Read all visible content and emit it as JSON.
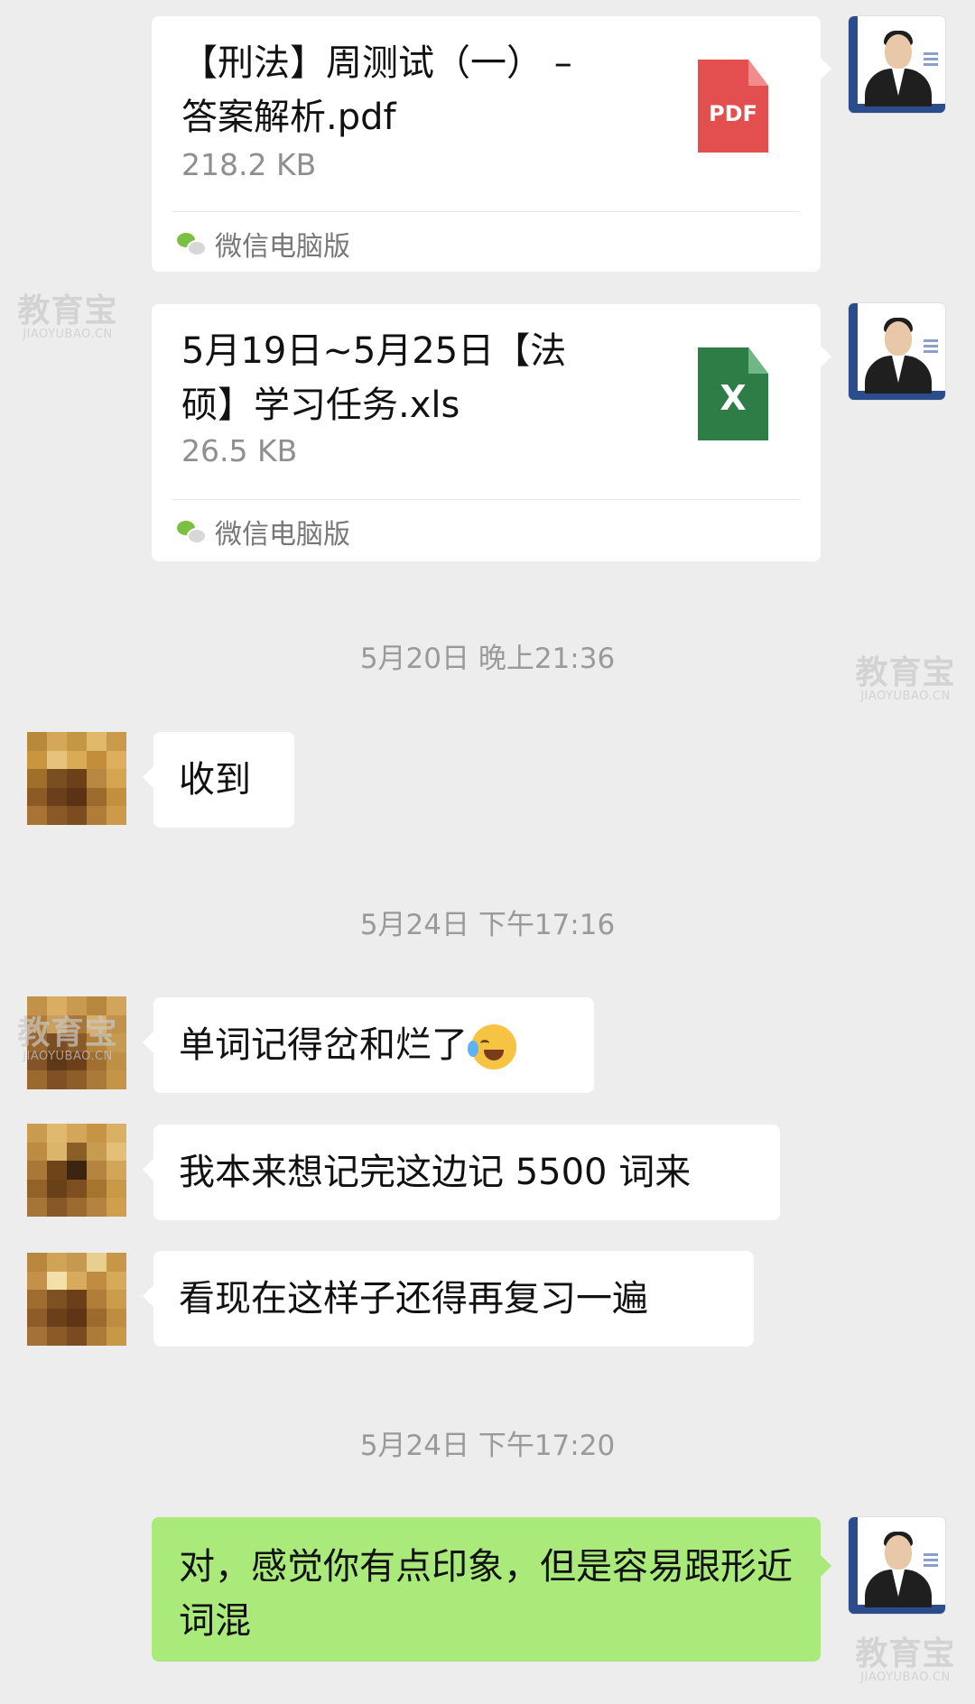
{
  "messages": {
    "file1": {
      "title": "【刑法】周测试（一） – 答案解析.pdf",
      "size": "218.2 KB",
      "source": "微信电脑版",
      "icon": "pdf-file-icon",
      "icon_label": "PDF",
      "icon_color": "#e34f4f"
    },
    "file2": {
      "title": "5月19日~5月25日【法硕】学习任务.xls",
      "size": "26.5 KB",
      "source": "微信电脑版",
      "icon": "excel-file-icon",
      "icon_label": "X",
      "icon_color": "#2e7d46"
    },
    "timestamp1": "5月20日 晚上21:36",
    "reply1": "收到",
    "timestamp2": "5月24日 下午17:16",
    "reply2": "单词记得岔和烂了",
    "reply2_emoji": "crying-laughing-emoji",
    "reply3": "我本来想记完这边记 5500 词来",
    "reply4": "看现在这样子还得再复习一遍",
    "timestamp3": "5月24日 下午17:20",
    "sent1": "对，感觉你有点印象，但是容易跟形近词混"
  },
  "watermark": {
    "brand": "教育宝",
    "domain": "JIAOYUBAO.CN"
  },
  "colors": {
    "background": "#ededed",
    "sent_bubble": "#a9ea7a",
    "received_bubble": "#ffffff"
  }
}
